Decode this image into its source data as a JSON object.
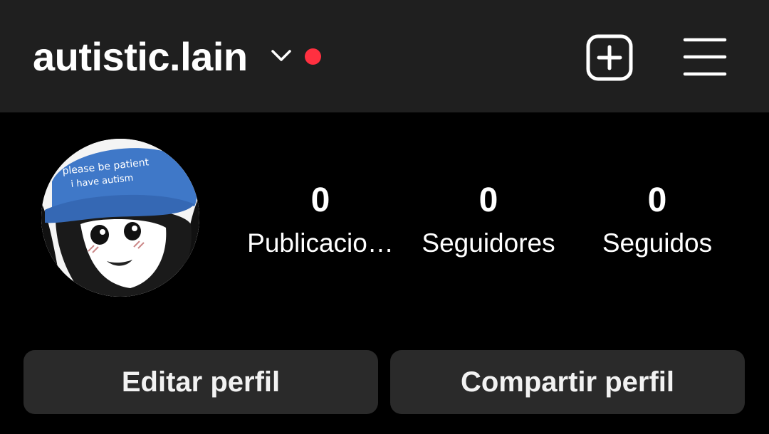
{
  "header": {
    "username": "autistic.lain",
    "icons": {
      "dropdown": "chevron-down-icon",
      "notification": "red-dot-indicator",
      "create": "add-square-icon",
      "menu": "hamburger-menu-icon"
    }
  },
  "profile": {
    "avatar_text_line1": "please be patient",
    "avatar_text_line2": "i have autism",
    "stats": [
      {
        "value": "0",
        "label": "Publicacio…"
      },
      {
        "value": "0",
        "label": "Seguidores"
      },
      {
        "value": "0",
        "label": "Seguidos"
      }
    ]
  },
  "actions": {
    "edit_label": "Editar perfil",
    "share_label": "Compartir perfil"
  },
  "colors": {
    "background": "#000000",
    "topbar": "#1f1f1f",
    "button": "#2a2a2a",
    "notification_dot": "#ff3040",
    "hat_blue": "#3f78c8"
  }
}
